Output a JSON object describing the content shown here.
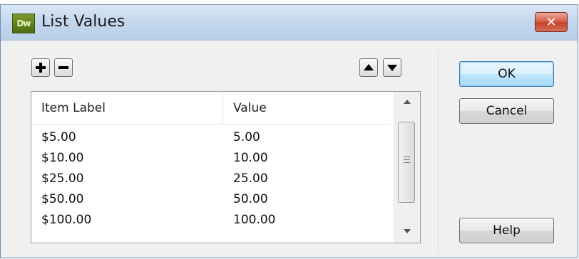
{
  "window": {
    "title": "List Values",
    "app_icon_label": "Dw",
    "close_glyph": "✕"
  },
  "toolbar": {
    "add_icon": "plus-icon",
    "remove_icon": "minus-icon",
    "move_up_icon": "triangle-up-icon",
    "move_down_icon": "triangle-down-icon"
  },
  "list": {
    "columns": [
      "Item Label",
      "Value"
    ],
    "rows": [
      {
        "label": "$5.00",
        "value": "5.00"
      },
      {
        "label": "$10.00",
        "value": "10.00"
      },
      {
        "label": "$25.00",
        "value": "25.00"
      },
      {
        "label": "$50.00",
        "value": "50.00"
      },
      {
        "label": "$100.00",
        "value": "100.00"
      }
    ]
  },
  "buttons": {
    "ok": "OK",
    "cancel": "Cancel",
    "help": "Help"
  },
  "colors": {
    "title_bar": "#c4d8ee",
    "close_button": "#d9624c",
    "default_button_border": "#3c7fb1",
    "app_icon": "#5f7f1e"
  }
}
